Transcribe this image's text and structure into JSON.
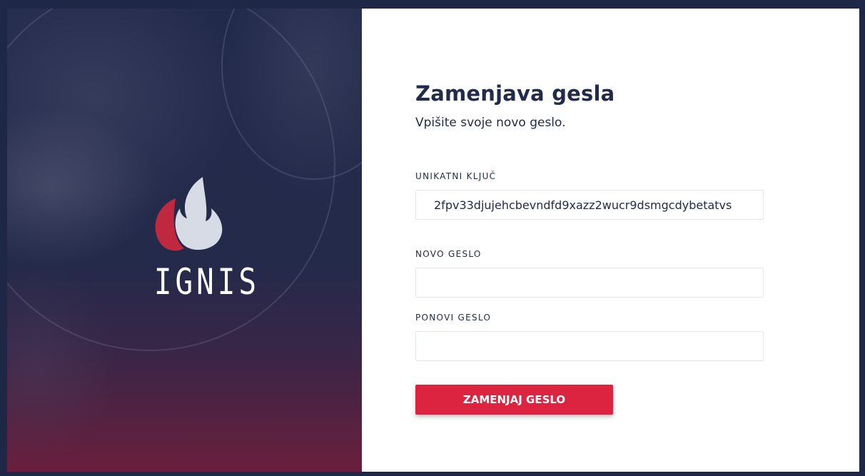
{
  "brand": {
    "name": "IGNIS",
    "colors": {
      "navy": "#232b4a",
      "accent": "#dc2440",
      "flame_light": "#d7dbe6"
    }
  },
  "form": {
    "title": "Zamenjava gesla",
    "subtitle": "Vpišite svoje novo geslo.",
    "key_label": "UNIKATNI KLJUČ",
    "key_value": "2fpv33djujehcbevndfd9xazz2wucr9dsmgcdybetatvs",
    "new_password_label": "NOVO GESLO",
    "new_password_value": "",
    "repeat_password_label": "PONOVI GESLO",
    "repeat_password_value": "",
    "submit_label": "ZAMENJAJ GESLO"
  }
}
